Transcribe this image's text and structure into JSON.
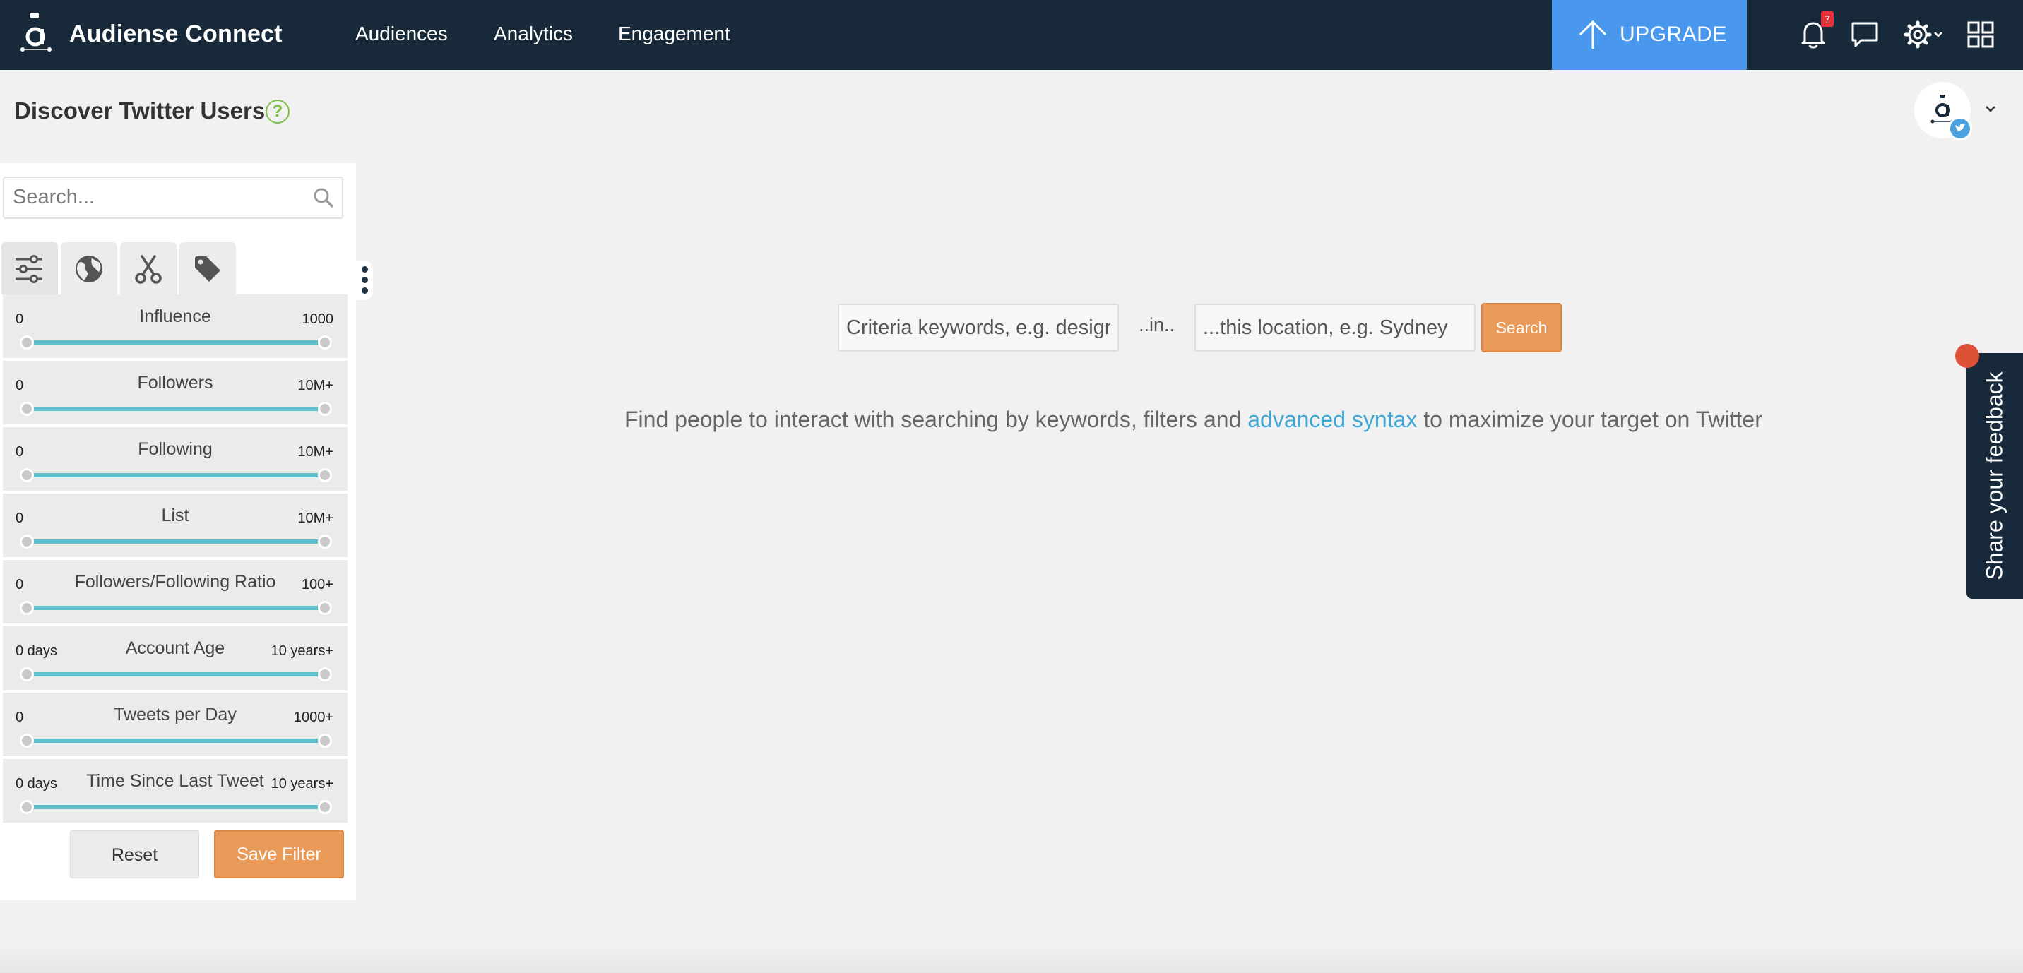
{
  "app": {
    "brand": "Audiense Connect",
    "nav": [
      {
        "label": "Audiences"
      },
      {
        "label": "Analytics"
      },
      {
        "label": "Engagement"
      }
    ],
    "upgrade_label": "UPGRADE",
    "notification_count": "7",
    "colors": {
      "topbar": "#18293a",
      "upgrade": "#4a97ee",
      "accent_orange": "#e99a59",
      "slider": "#5ebfcc",
      "link": "#3fa7d6"
    }
  },
  "header": {
    "title": "Discover Twitter Users",
    "help_symbol": "?"
  },
  "sidebar": {
    "search_placeholder": "Search...",
    "tabs": [
      {
        "icon": "sliders-icon"
      },
      {
        "icon": "globe-icon"
      },
      {
        "icon": "scissors-icon"
      },
      {
        "icon": "tag-icon"
      }
    ],
    "filters": [
      {
        "label": "Influence",
        "min": "0",
        "max": "1000",
        "range": [
          0,
          1
        ]
      },
      {
        "label": "Followers",
        "min": "0",
        "max": "10M+",
        "range": [
          0,
          1
        ]
      },
      {
        "label": "Following",
        "min": "0",
        "max": "10M+",
        "range": [
          0,
          1
        ]
      },
      {
        "label": "List",
        "min": "0",
        "max": "10M+",
        "range": [
          0,
          1
        ]
      },
      {
        "label": "Followers/Following Ratio",
        "min": "0",
        "max": "100+",
        "range": [
          0,
          1
        ]
      },
      {
        "label": "Account Age",
        "min": "0 days",
        "max": "10 years+",
        "range": [
          0,
          1
        ]
      },
      {
        "label": "Tweets per Day",
        "min": "0",
        "max": "1000+",
        "range": [
          0,
          1
        ]
      },
      {
        "label": "Time Since Last Tweet",
        "min": "0 days",
        "max": "10 years+",
        "range": [
          0,
          1
        ]
      }
    ],
    "reset_label": "Reset",
    "save_label": "Save Filter"
  },
  "main": {
    "keywords_placeholder": "Criteria keywords, e.g. designer",
    "in_label": "..in..",
    "location_placeholder": "...this location, e.g. Sydney",
    "search_label": "Search",
    "info_before": "Find people to interact with searching by keywords, filters and ",
    "info_link": "advanced syntax",
    "info_after": " to maximize your target on Twitter"
  },
  "feedback": {
    "label": "Share your feedback"
  }
}
